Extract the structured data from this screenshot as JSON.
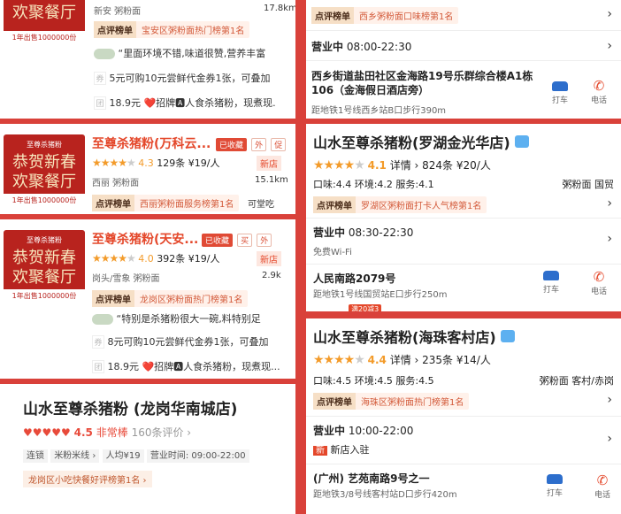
{
  "thumb_brand": "至尊杀猪粉",
  "thumb_line1": "恭贺新春",
  "thumb_line2": "欢聚餐厅",
  "thumb_sold": "1年出售1000000份",
  "card_a": {
    "title_partial": "欢聚餐厅",
    "sold": "1年出售1000000份",
    "loc": "新安  粥粉面",
    "distance": "17.8km",
    "rank_label": "点评榜单",
    "rank_text": "宝安区粥粉面热门榜第1名",
    "review": "“里面环境不错,味道很赞,营养丰富",
    "voucher_tag": "券",
    "voucher": "5元可购10元尝鲜代金券1张，可叠加",
    "group_tag": "团",
    "group": "18.9元 ❤️招牌🅰人食杀猪粉，现煮现."
  },
  "card_b": {
    "title": "至尊杀猪粉(万科云...",
    "collected": "已收藏",
    "tags": [
      "外",
      "促"
    ],
    "rating": "4.3",
    "reviews": "129条",
    "price": "¥19/人",
    "new_badge": "新店",
    "loc": "西丽  粥粉面",
    "distance": "15.1km",
    "rank_label": "点评榜单",
    "rank_text": "西丽粥粉面服务榜第1名",
    "extra": "可堂吃"
  },
  "card_c": {
    "title": "至尊杀猪粉(天安...",
    "collected": "已收藏",
    "tags": [
      "买",
      "外"
    ],
    "rating": "4.0",
    "reviews": "392条",
    "price": "¥19/人",
    "new_badge": "新店",
    "loc": "岗头/雪象  粥粉面",
    "distance": "2.9k",
    "rank_label": "点评榜单",
    "rank_text": "龙岗区粥粉面热门榜第1名",
    "review": "“特别是杀猪粉很大一碗,料特别足",
    "voucher_tag": "券",
    "voucher": "8元可购10元尝鲜代金券1张，可叠加",
    "group_tag": "团",
    "group": "18.9元 ❤️招牌🅰人食杀猪粉，现煮现..."
  },
  "card_d": {
    "title": "山水至尊杀猪粉 (龙岗华南城店)",
    "rating": "4.5",
    "rating_word": "非常棒",
    "reviews": "160条评价 ›",
    "chips": [
      "连锁",
      "米粉米线 ›",
      "人均¥19",
      "营业时间: 09:00-22:00"
    ],
    "rank": "龙岗区小吃快餐好评榜第1名 ›"
  },
  "right_1": {
    "rank_label": "点评榜单",
    "rank_text": "西乡粥粉面口味榜第1名",
    "hours_label": "营业中",
    "hours": "08:00-22:30",
    "address": "西乡街道盐田社区金海路19号乐群综合楼A1栋106（金海假日酒店旁）",
    "metro": "距地铁1号线西乡站B口步行390m",
    "taxi": "打车",
    "phone": "电话"
  },
  "right_2": {
    "title": "山水至尊杀猪粉(罗湖金光华店)",
    "rating": "4.1",
    "detail": "详情 ›",
    "reviews": "824条",
    "price": "¥20/人",
    "scores": "口味:4.4  环境:4.2  服务:4.1",
    "cat": "粥粉面  国贸",
    "rank_label": "点评榜单",
    "rank_text": "罗湖区粥粉面打卡人气榜第1名",
    "hours_label": "营业中",
    "hours": "08:30-22:30",
    "wifi": "免费Wi-Fi",
    "address": "人民南路2079号",
    "metro": "距地铁1号线国贸站E口步行250m",
    "taxi": "打车",
    "phone": "电话",
    "promo": "满20减3"
  },
  "right_3": {
    "title": "山水至尊杀猪粉(海珠客村店)",
    "rating": "4.4",
    "detail": "详情 ›",
    "reviews": "235条",
    "price": "¥14/人",
    "scores": "口味:4.5  环境:4.5  服务:4.5",
    "cat": "粥粉面  客村/赤岗",
    "rank_label": "点评榜单",
    "rank_text": "海珠区粥粉面热门榜第1名",
    "hours_label": "营业中",
    "hours": "10:00-22:00",
    "new_tag": "新",
    "new_text": "新店入驻",
    "address": "(广州) 艺苑南路9号之一",
    "metro": "距地铁3/8号线客村站D口步行420m",
    "taxi": "打车",
    "phone": "电话"
  }
}
